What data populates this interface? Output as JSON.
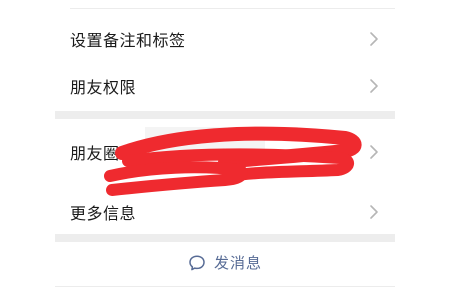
{
  "profile_menu": {
    "items": [
      {
        "label": "设置备注和标签"
      },
      {
        "label": "朋友权限"
      },
      {
        "label": "朋友圈"
      },
      {
        "label": "更多信息"
      }
    ]
  },
  "actions": {
    "send_message_label": "发消息"
  },
  "colors": {
    "link": "#576b95",
    "redaction": "#ef2a2f",
    "section_gap": "#ededed"
  }
}
